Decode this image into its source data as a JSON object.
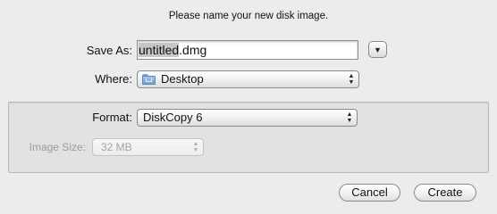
{
  "dialog": {
    "prompt": "Please name your new disk image."
  },
  "save_as": {
    "label": "Save As:",
    "value_selected": "untitled",
    "value_rest": ".dmg"
  },
  "where": {
    "label": "Where:",
    "value": "Desktop",
    "icon": "folder-icon"
  },
  "format": {
    "label": "Format:",
    "value": "DiskCopy 6"
  },
  "image_size": {
    "label": "Image Size:",
    "value": "32 MB",
    "enabled": false
  },
  "buttons": {
    "cancel": "Cancel",
    "create": "Create"
  }
}
